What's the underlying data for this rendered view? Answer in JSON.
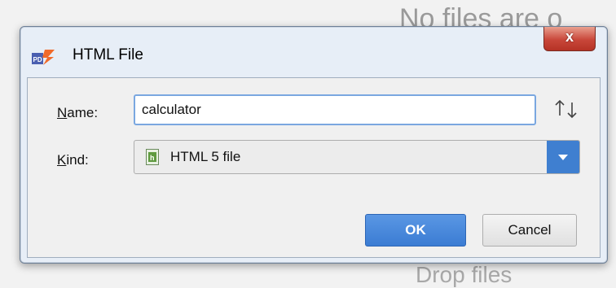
{
  "background": {
    "top_text": "No files are o",
    "bottom_text": "Drop  files"
  },
  "dialog": {
    "title": "HTML File",
    "close_label": "x",
    "name_label_accel": "N",
    "name_label_rest": "ame:",
    "name_value": "calculator",
    "kind_label_accel": "K",
    "kind_label_rest": "ind:",
    "kind_value": "HTML 5 file",
    "ok_label": "OK",
    "cancel_label": "Cancel",
    "app_icon": "phpstorm-icon",
    "sort_icon": "sort-arrows-icon",
    "file_icon": "html-file-icon",
    "dropdown_icon": "chevron-down-icon",
    "colors": {
      "accent": "#3b7cd3",
      "close": "#c9473a",
      "focus_border": "#7aa7e0"
    }
  }
}
